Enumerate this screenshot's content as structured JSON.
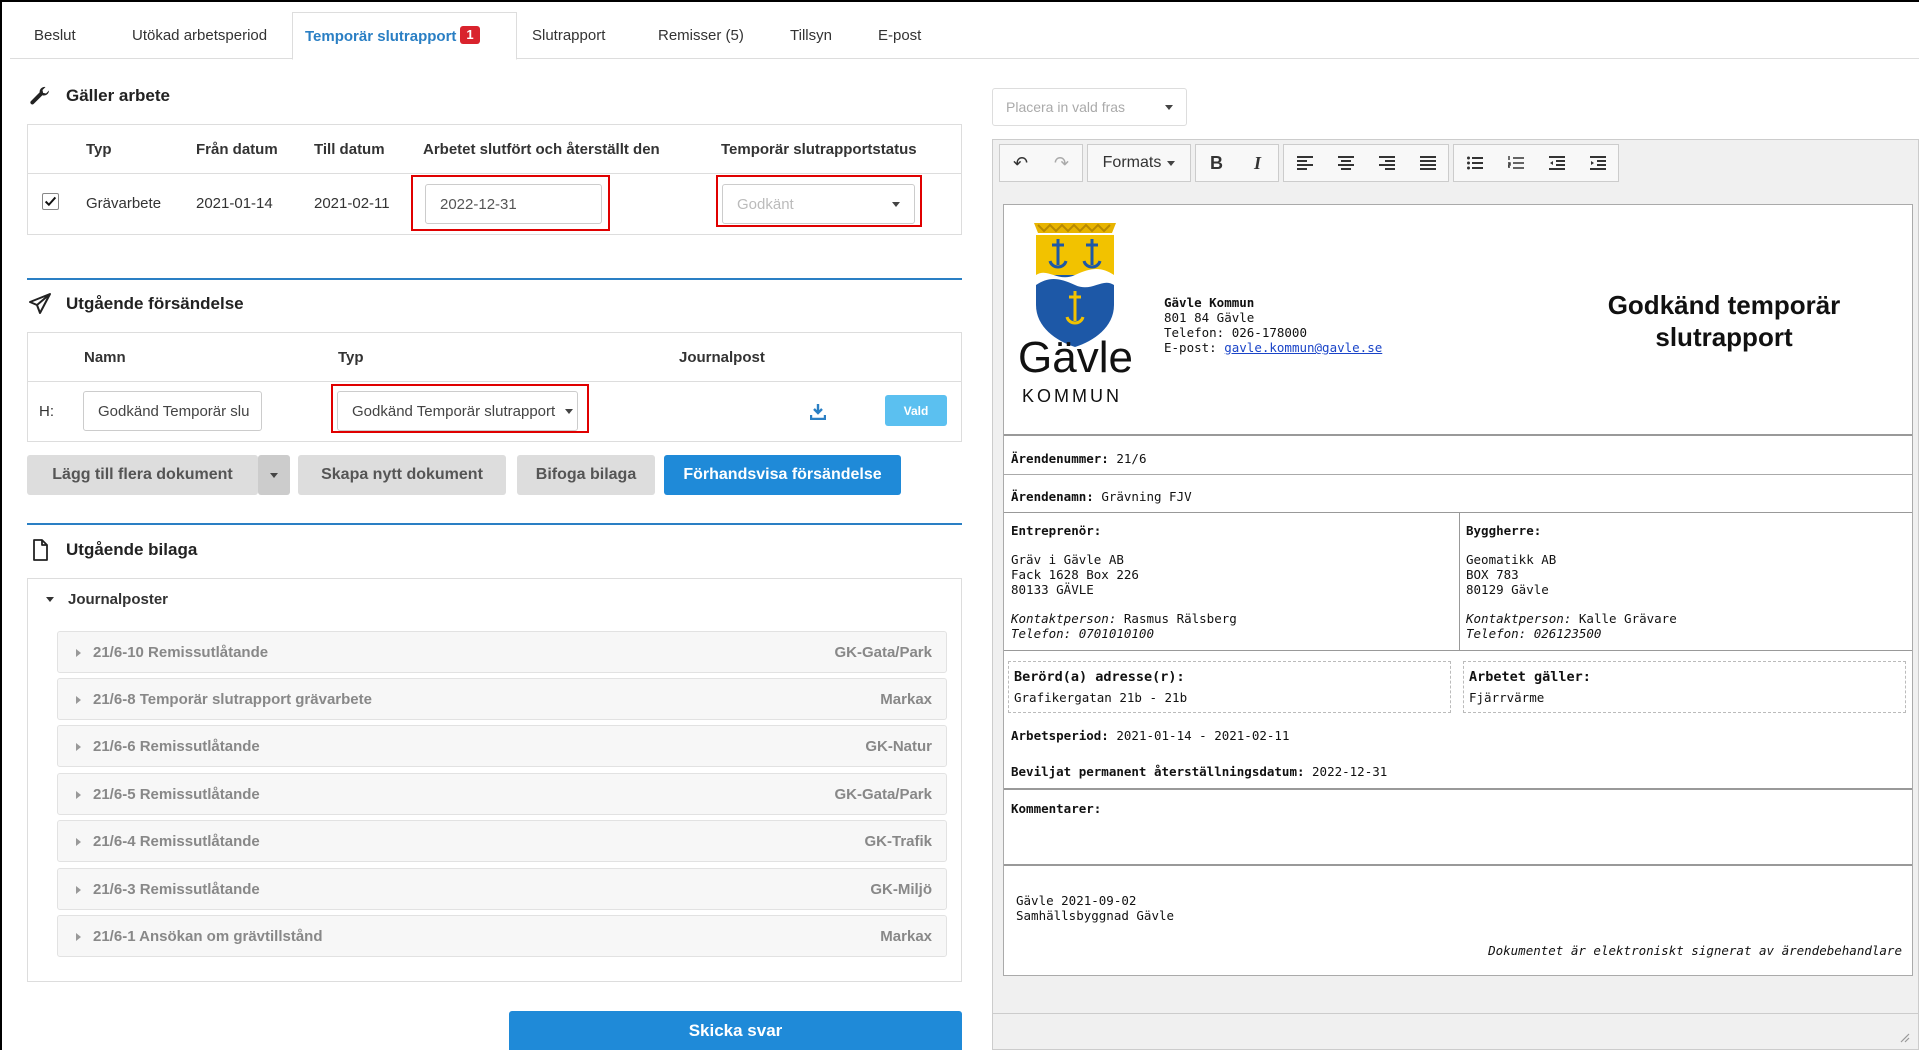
{
  "tabs": [
    {
      "label": "Beslut"
    },
    {
      "label": "Utökad arbetsperiod"
    },
    {
      "label": "Temporär slutrapport",
      "badge": "1"
    },
    {
      "label": "Slutrapport"
    },
    {
      "label": "Remisser (5)"
    },
    {
      "label": "Tillsyn"
    },
    {
      "label": "E-post"
    }
  ],
  "galler": {
    "title": "Gäller arbete",
    "headers": [
      "Typ",
      "Från datum",
      "Till datum",
      "Arbetet slutfört och återställt den",
      "Temporär slutrapportstatus"
    ],
    "row": {
      "typ": "Grävarbete",
      "from": "2021-01-14",
      "to": "2021-02-11",
      "done_value": "2022-12-31",
      "status_placeholder": "Godkänt"
    }
  },
  "utgaende": {
    "title": "Utgående försändelse",
    "headers": [
      "Namn",
      "Typ",
      "Journalpost"
    ],
    "row": {
      "prefix": "H:",
      "name_value": "Godkänd Temporär slu",
      "typ_value": "Godkänd Temporär slutrapport",
      "action": "Vald"
    },
    "buttons": {
      "add": "Lägg till flera dokument",
      "create": "Skapa nytt dokument",
      "attach": "Bifoga bilaga",
      "preview": "Förhandsvisa försändelse"
    }
  },
  "bilaga": {
    "title": "Utgående bilaga",
    "group": "Journalposter",
    "items": [
      {
        "label": "21/6-10 Remissutlåtande",
        "dept": "GK-Gata/Park"
      },
      {
        "label": "21/6-8 Temporär slutrapport grävarbete",
        "dept": "Markax"
      },
      {
        "label": "21/6-6 Remissutlåtande",
        "dept": "GK-Natur"
      },
      {
        "label": "21/6-5 Remissutlåtande",
        "dept": "GK-Gata/Park"
      },
      {
        "label": "21/6-4 Remissutlåtande",
        "dept": "GK-Trafik"
      },
      {
        "label": "21/6-3 Remissutlåtande",
        "dept": "GK-Miljö"
      },
      {
        "label": "21/6-1 Ansökan om grävtillstånd",
        "dept": "Markax"
      }
    ]
  },
  "send_label": "Skicka svar",
  "editor": {
    "phrase_placeholder": "Placera in vald fras",
    "formats": "Formats"
  },
  "doc": {
    "logo_name": "Gävle",
    "logo_sub": "KOMMUN",
    "org": "Gävle Kommun",
    "addr": "801 84 Gävle",
    "phone": "Telefon: 026-178000",
    "email_label": "E-post: ",
    "email": "gavle.kommun@gavle.se",
    "title_line1": "Godkänd temporär",
    "title_line2": "slutrapport",
    "arendenummer_label": "Ärendenummer:",
    "arendenummer": "21/6",
    "arendenamn_label": "Ärendenamn:",
    "arendenamn": "Grävning FJV",
    "entreprenor_label": "Entreprenör:",
    "entreprenor": [
      "Gräv i Gävle AB",
      "Fack 1628 Box 226",
      "80133 GÄVLE"
    ],
    "entreprenor_contact_label": "Kontaktperson:",
    "entreprenor_contact": "Rasmus Rälsberg",
    "entreprenor_phone": "Telefon: 0701010100",
    "byggherre_label": "Byggherre:",
    "byggherre": [
      "Geomatikk AB",
      "BOX 783",
      "80129 Gävle"
    ],
    "byggherre_contact_label": "Kontaktperson:",
    "byggherre_contact": "Kalle Grävare",
    "byggherre_phone": "Telefon: 026123500",
    "berord_label": "Berörd(a) adresse(r):",
    "berord": "Grafikergatan 21b - 21b",
    "arbetet_label": "Arbetet gäller:",
    "arbetet": "Fjärrvärme",
    "period_label": "Arbetsperiod:",
    "period": "2021-01-14 - 2021-02-11",
    "beviljat_label": "Beviljat permanent återställningsdatum:",
    "beviljat": "2022-12-31",
    "kommentarer_label": "Kommentarer:",
    "sign_place": "Gävle 2021-09-02",
    "sign_org": "Samhällsbyggnad Gävle",
    "signed_note": "Dokumentet är elektroniskt signerat av ärendebehandlare"
  },
  "colors": {
    "accent": "#1f8ad8",
    "highlight": "#e00000",
    "badge": "#d9232d"
  }
}
